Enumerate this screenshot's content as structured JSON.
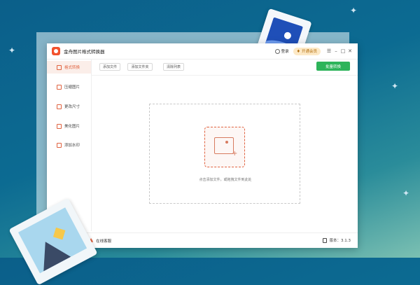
{
  "app": {
    "title": "金舟图片格式转换器",
    "login_label": "登录",
    "vip_label": "开通会员"
  },
  "sidebar": {
    "items": [
      {
        "label": "格式转换",
        "icon": "image-convert-icon",
        "active": true
      },
      {
        "label": "压缩图片",
        "icon": "compress-image-icon"
      },
      {
        "label": "更改尺寸",
        "icon": "resize-icon"
      },
      {
        "label": "美化图片",
        "icon": "beautify-icon"
      },
      {
        "label": "添加水印",
        "icon": "watermark-icon"
      }
    ]
  },
  "toolbar": {
    "add_file": "添加文件",
    "add_folder": "添加文件夹",
    "clear_list": "清除列表",
    "batch_convert": "批量转换"
  },
  "dropzone": {
    "hint": "点击添加文件，或拖拽文件到此处",
    "icon": "add-image-icon"
  },
  "statusbar": {
    "help_label": "在线客服",
    "version_label": "版本：3.1.3"
  },
  "colors": {
    "accent": "#e0623f",
    "convert_button": "#2db45a",
    "vip_background": "#fde9c6"
  }
}
